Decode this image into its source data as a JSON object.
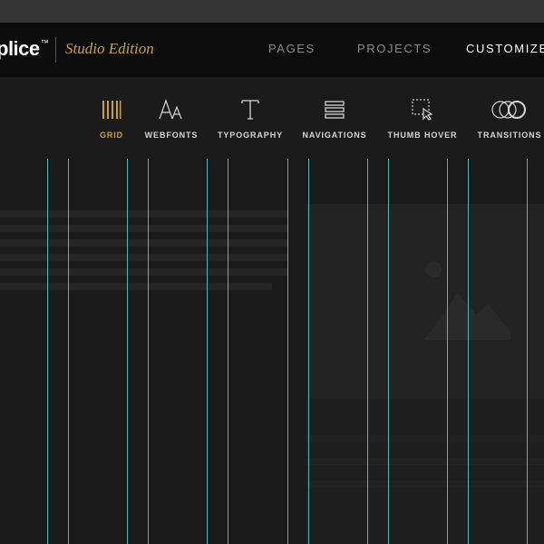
{
  "header": {
    "brand": "plice",
    "brand_tm": "™",
    "edition": "Studio Edition",
    "nav": [
      {
        "label": "PAGES",
        "active": false
      },
      {
        "label": "PROJECTS",
        "active": false
      },
      {
        "label": "CUSTOMIZE",
        "active": true
      }
    ]
  },
  "toolbar": {
    "items": [
      {
        "label": "GRID",
        "icon": "grid-icon",
        "active": true
      },
      {
        "label": "WEBFONTS",
        "icon": "webfonts-icon",
        "active": false
      },
      {
        "label": "TYPOGRAPHY",
        "icon": "typography-icon",
        "active": false
      },
      {
        "label": "NAVIGATIONS",
        "icon": "navigations-icon",
        "active": false
      },
      {
        "label": "THUMB HOVER",
        "icon": "thumb-hover-icon",
        "active": false
      },
      {
        "label": "TRANSITIONS",
        "icon": "transitions-icon",
        "active": false
      }
    ],
    "active_color": "#c9a23a",
    "icon_color": "#d6d6d6"
  },
  "grid_overlay": {
    "line_color": "#4fb8b4"
  }
}
